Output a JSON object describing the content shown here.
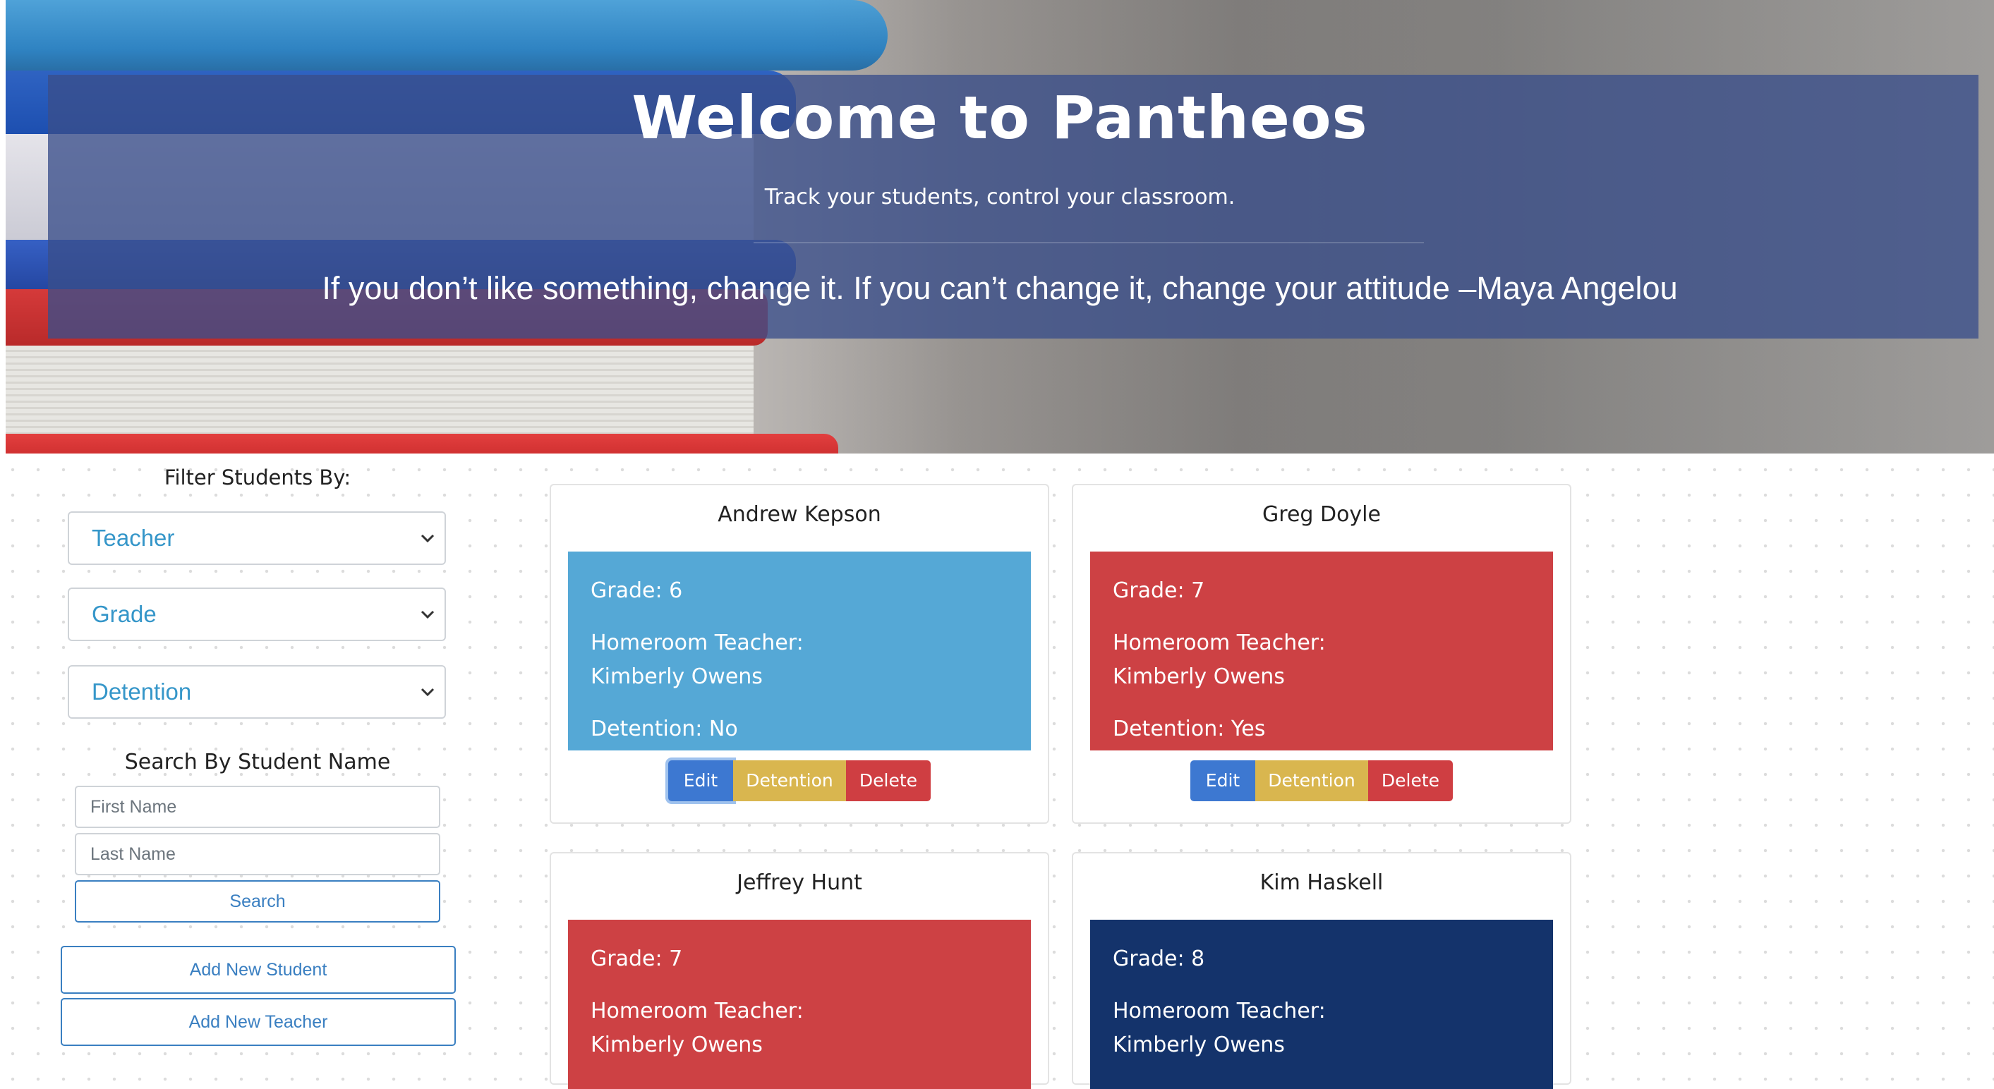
{
  "hero": {
    "title": "Welcome to Pantheos",
    "subtitle": "Track your students, control your classroom.",
    "quote": "If you don’t like something, change it. If you can’t change it, change your attitude –Maya Angelou"
  },
  "sidebar": {
    "filter_heading": "Filter Students By:",
    "filters": {
      "teacher": "Teacher",
      "grade": "Grade",
      "detention": "Detention"
    },
    "search_heading": "Search By Student Name",
    "first_name_placeholder": "First Name",
    "last_name_placeholder": "Last Name",
    "search_label": "Search",
    "add_student_label": "Add New Student",
    "add_teacher_label": "Add New Teacher"
  },
  "card_labels": {
    "edit": "Edit",
    "detention": "Detention",
    "delete": "Delete"
  },
  "students": [
    {
      "name": "Andrew Kepson",
      "grade": "Grade: 6",
      "teacher_label": "Homeroom Teacher:",
      "teacher": "Kimberly Owens",
      "detention": "Detention: No",
      "color": "#55a8d6"
    },
    {
      "name": "Greg Doyle",
      "grade": "Grade: 7",
      "teacher_label": "Homeroom Teacher:",
      "teacher": "Kimberly Owens",
      "detention": "Detention: Yes",
      "color": "#cd4144"
    },
    {
      "name": "Jeffrey Hunt",
      "grade": "Grade: 7",
      "teacher_label": "Homeroom Teacher:",
      "teacher": "Kimberly Owens",
      "detention": "",
      "color": "#cd4144"
    },
    {
      "name": "Kim Haskell",
      "grade": "Grade: 8",
      "teacher_label": "Homeroom Teacher:",
      "teacher": "Kimberly Owens",
      "detention": "",
      "color": "#14336b"
    }
  ],
  "colors": {
    "accent": "#3a7fc1",
    "select_text": "#3596c9",
    "hero_overlay": "#3a4e8a"
  }
}
